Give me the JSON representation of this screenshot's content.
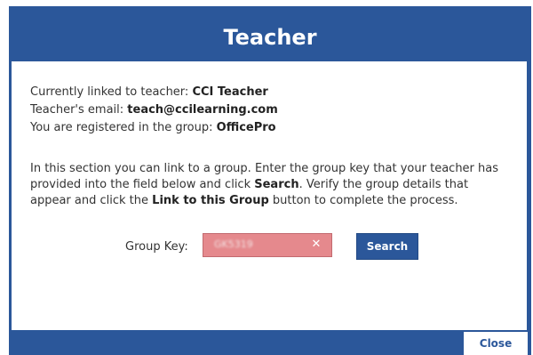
{
  "dialog": {
    "title": "Teacher",
    "accent_color": "#2b579a"
  },
  "info": {
    "linked_label": "Currently linked to teacher:",
    "linked_value": "CCI Teacher",
    "email_label": "Teacher's email:",
    "email_value": "teach@ccilearning.com",
    "group_label": "You are registered in the group:",
    "group_value": "OfficePro"
  },
  "description": {
    "part1": "In this section you can link to a group. Enter the group key that your teacher has provided into the field below and click ",
    "search_word": "Search",
    "part2": ". Verify the group details that appear and click the ",
    "link_word": "Link to this Group",
    "part3": " button to complete the process."
  },
  "group_key": {
    "label": "Group Key:",
    "value": "GK5319",
    "clear_icon": "clear-icon",
    "field_color": "#e5898d"
  },
  "buttons": {
    "search_label": "Search",
    "close_label": "Close"
  }
}
